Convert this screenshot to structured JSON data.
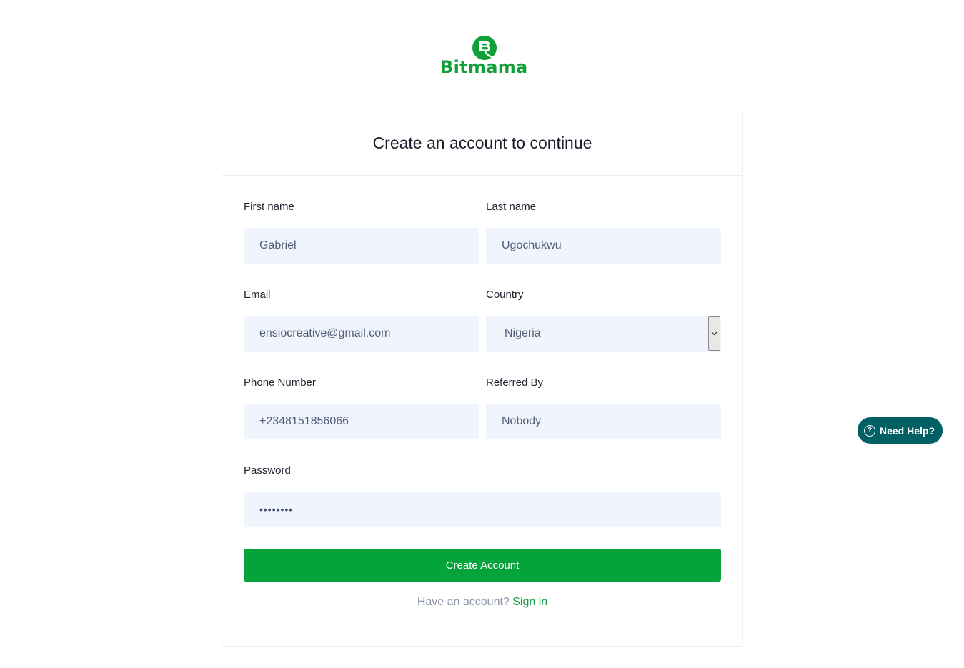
{
  "brand": {
    "name": "Bitmama",
    "color": "#10a038"
  },
  "card": {
    "title": "Create an account to continue"
  },
  "form": {
    "first_name": {
      "label": "First name",
      "value": "Gabriel"
    },
    "last_name": {
      "label": "Last name",
      "value": "Ugochukwu"
    },
    "email": {
      "label": "Email",
      "value": "ensiocreative@gmail.com"
    },
    "country": {
      "label": "Country",
      "value": "Nigeria"
    },
    "phone": {
      "label": "Phone Number",
      "value": "+2348151856066"
    },
    "referred_by": {
      "label": "Referred By",
      "value": "Nobody"
    },
    "password": {
      "label": "Password",
      "value": "••••••••"
    },
    "submit_label": "Create Account",
    "signin_prompt": "Have an account?",
    "signin_link": "Sign in"
  },
  "help": {
    "label": "Need Help?",
    "icon": "question-icon",
    "color": "#006064"
  },
  "colors": {
    "accent": "#04a43a",
    "input_bg": "#f0f5fd"
  }
}
